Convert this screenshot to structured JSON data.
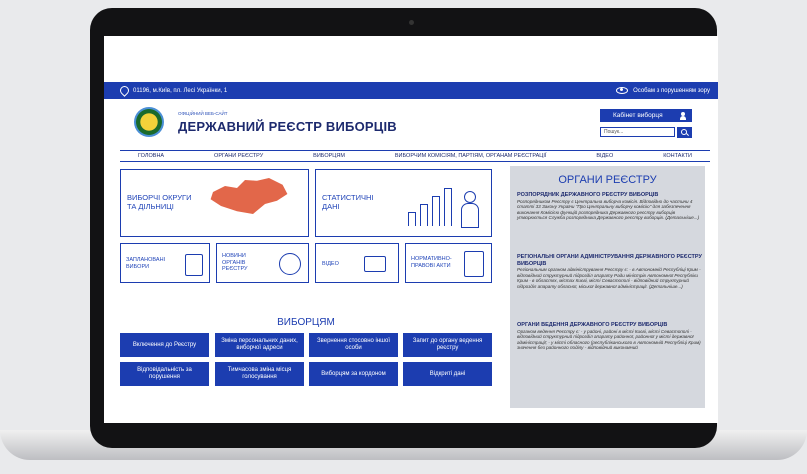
{
  "topbar": {
    "address": "01196, м.Київ, пл. Лесі Українки, 1",
    "accessibility": "Особам з порушенням зору"
  },
  "header": {
    "official": "ОФІЦІЙНИЙ ВЕБ-САЙТ",
    "title": "ДЕРЖАВНИЙ РЕЄСТР ВИБОРЦІВ",
    "cabinet": "Кабінет виборця",
    "search_placeholder": "Пошук..."
  },
  "nav": [
    "ГОЛОВНА",
    "ОРГАНИ РЕЄСТРУ",
    "ВИБОРЦЯМ",
    "ВИБОРЧИМ КОМІСІЯМ, ПАРТІЯМ, ОРГАНАМ РЕЄСТРАЦІЇ",
    "ВІДЕО",
    "КОНТАКТИ"
  ],
  "tiles": {
    "districts": "ВИБОРЧІ ОКРУГИ ТА ДІЛЬНИЦІ",
    "stats": "СТАТИСТИЧНІ ДАНІ",
    "planned": "ЗАПЛАНОВАНІ ВИБОРИ",
    "news": "НОВИНИ ОРГАНІВ РЕЄСТРУ",
    "video": "ВІДЕО",
    "legal": "НОРМАТИВНО-ПРАВОВІ АКТИ"
  },
  "voters": {
    "heading": "ВИБОРЦЯМ",
    "buttons": [
      "Включення до Реєстру",
      "Зміна персональних даних, виборчої адреси",
      "Звернення стосовно іншої особи",
      "Запит до органу ведення реєстру",
      "Відповідальність за порушення",
      "Тимчасова зміна місця голосування",
      "Виборцям за кордоном",
      "Відкриті дані"
    ]
  },
  "sidebar": {
    "title": "ОРГАНИ РЕЄСТРУ",
    "sections": [
      {
        "heading": "РОЗПОРЯДНИК ДЕРЖАВНОГО РЕЄСТРУ ВИБОРЦІВ",
        "text": "Розпорядником Реєстру є Центральна виборча комісія. Відповідно до частини 4 статті 33 Закону України \"Про Центральну виборчу комісію\" для забезпечення виконання Комісією функцій розпорядника Державного реєстру виборців утворюється Служба розпорядника Державного реєстру виборців. (Детальніше...)"
      },
      {
        "heading": "РЕГІОНАЛЬНІ ОРГАНИ АДМІНІСТРУВАННЯ ДЕРЖАВНОГО РЕЄСТРУ ВИБОРЦІВ",
        "text": "Регіональним органом адміністрування Реєстру є: - в Автономній Республіці Крим - відповідний структурний підрозділ апарату Ради міністрів Автономної Республіки Крим - в областях, містах Києві, місті Севастополі - відповідний структурний підрозділ апарату обласної, міської державної адміністрації. (Детальніше...)"
      },
      {
        "heading": "ОРГАНИ ВЕДЕННЯ ДЕРЖАВНОГО РЕЄСТРУ ВИБОРЦІВ",
        "text": "Органом ведення Реєстру є: - у районі, районі в місті Києві, місті Севастополі - відповідний структурний підрозділ апарату районної, районної у місті державної адміністрації; - у місті обласного (республіканського в Автономній Республіці Крим) значення без районного поділу - відповідний виконавчий"
      }
    ]
  },
  "colors": {
    "primary": "#1c3db0",
    "accent": "#e2674a",
    "sidebar": "#d5d8de"
  }
}
